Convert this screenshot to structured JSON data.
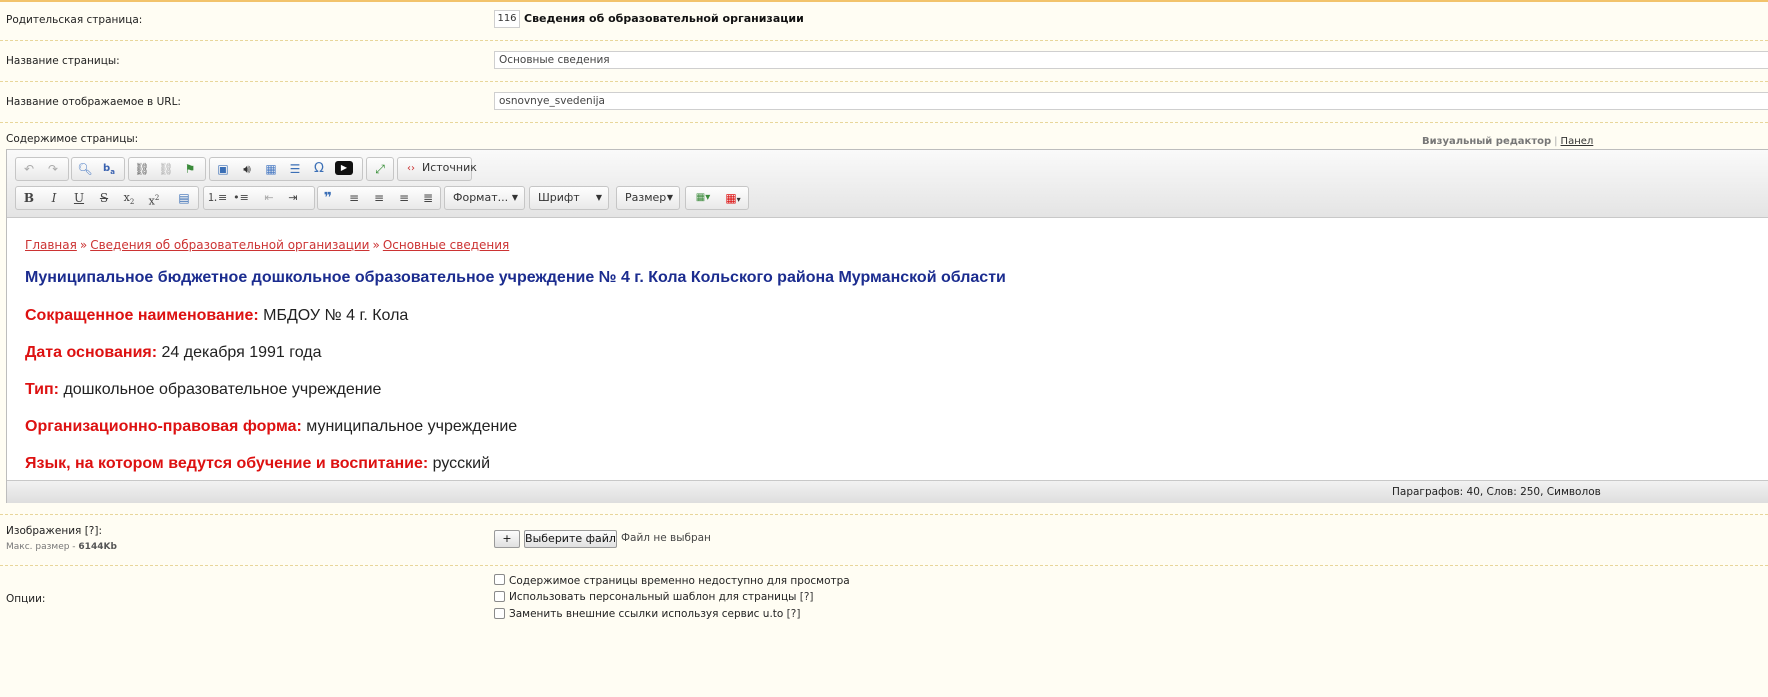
{
  "parent": {
    "label": "Родительская страница:",
    "id": "116",
    "title": "Сведения об образовательной организации"
  },
  "page_name": {
    "label": "Название страницы:",
    "value": "Основные сведения"
  },
  "url_name": {
    "label": "Название отображаемое в URL:",
    "value": "osnovnye_svedenija"
  },
  "content": {
    "label": "Содержимое страницы:",
    "editor_mode": {
      "visual": "Визуальный редактор",
      "sep": "|",
      "panel": "Панел"
    },
    "toolbar": {
      "source_label": "Источник",
      "format_label": "Формат...",
      "font_label": "Шрифт",
      "size_label": "Размер",
      "icons": [
        "undo-icon",
        "redo-icon",
        "find-icon",
        "replace-icon",
        "link-icon",
        "unlink-icon",
        "anchor-icon",
        "image-icon",
        "audio-icon",
        "table-icon",
        "hr-icon",
        "special-char-icon",
        "youtube-icon",
        "maximize-icon",
        "source-icon",
        "bold-icon",
        "italic-icon",
        "underline-icon",
        "strike-icon",
        "subscript-icon",
        "superscript-icon",
        "insert-image-icon",
        "numbered-list-icon",
        "bullet-list-icon",
        "outdent-icon",
        "indent-icon",
        "blockquote-icon",
        "align-left-icon",
        "align-center-icon",
        "align-right-icon",
        "justify-icon",
        "text-color-icon",
        "table-menu-icon"
      ]
    },
    "breadcrumbs": [
      "Главная",
      "Сведения об образовательной организации",
      "Основные сведения"
    ],
    "breadcrumb_sep": "»",
    "heading": "Муниципальное бюджетное дошкольное образовательное учреждение № 4 г. Кола Кольского района Мурманской области",
    "facts": [
      {
        "key": "Сокращенное наименование:",
        "value": " МБДОУ № 4 г. Кола"
      },
      {
        "key": "Дата основания:",
        "value": " 24 декабря 1991 года"
      },
      {
        "key": "Тип:",
        "value": " дошкольное образовательное учреждение"
      },
      {
        "key": "Организационно-правовая форма:",
        "value": " муниципальное учреждение"
      },
      {
        "key": "Язык, на котором ведутся обучение и воспитание:",
        "value": " русский"
      }
    ],
    "status": "Параграфов: 40, Слов: 250, Символов"
  },
  "images": {
    "label": "Изображения [?]:",
    "max_label": "Макс. размер - ",
    "max_value": "6144Kb",
    "plus": "+",
    "choose": "Выберите файл",
    "none": "Файл не выбран"
  },
  "options": {
    "label": "Опции:",
    "items": [
      {
        "label": "Содержимое страницы временно недоступно для просмотра",
        "hint": ""
      },
      {
        "label": "Использовать персональный шаблон для страницы",
        "hint": "[?]"
      },
      {
        "label": "Заменить внешние ссылки используя сервис u.to",
        "hint": "[?]"
      }
    ]
  }
}
